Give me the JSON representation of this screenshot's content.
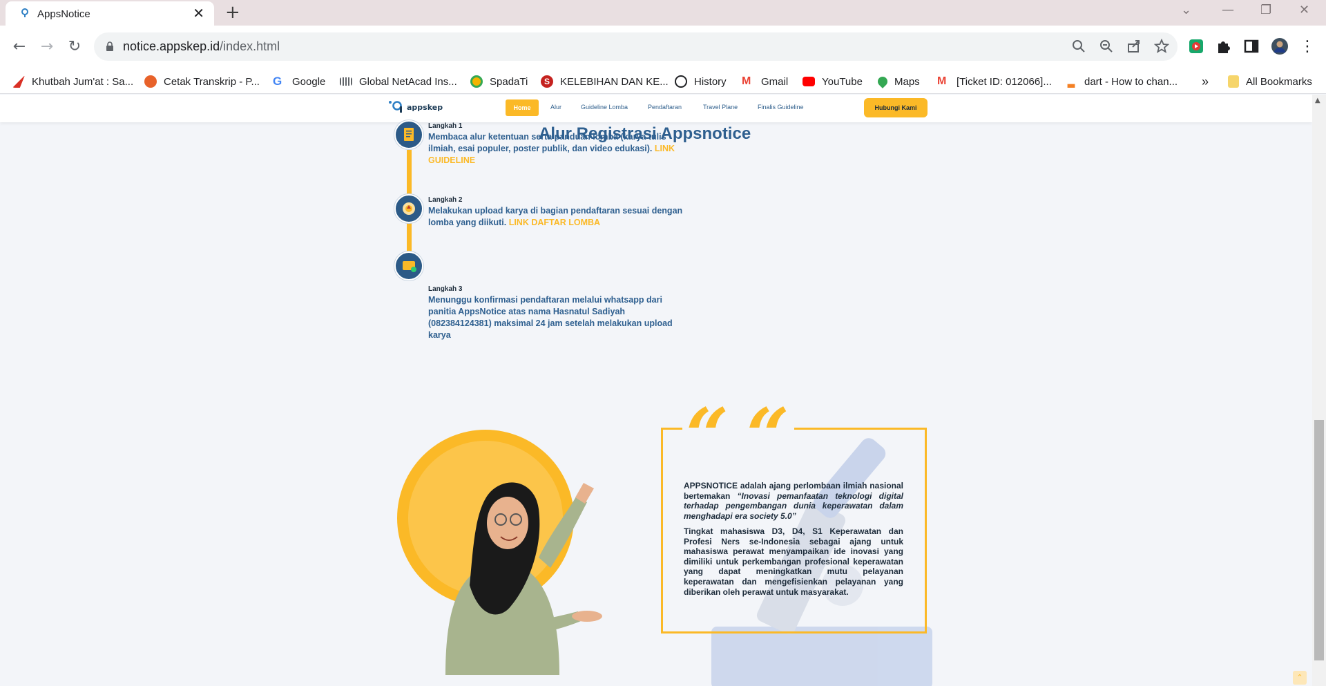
{
  "browser": {
    "tab_title": "AppsNotice",
    "url_host": "notice.appskep.id",
    "url_path": "/index.html",
    "bookmarks": [
      {
        "label": "Khutbah Jum'at : Sa...",
        "color": "#d93025"
      },
      {
        "label": "Cetak Transkrip - P...",
        "color": "#e8622a"
      },
      {
        "label": "Google",
        "color": "#4285f4"
      },
      {
        "label": "Global NetAcad Ins...",
        "color": "#5f6368"
      },
      {
        "label": "SpadaTi",
        "color": "#f4b400"
      },
      {
        "label": "KELEBIHAN DAN KE...",
        "color": "#c5221f"
      },
      {
        "label": "History",
        "color": "#202124"
      },
      {
        "label": "Gmail",
        "color": "#ea4335"
      },
      {
        "label": "YouTube",
        "color": "#ff0000"
      },
      {
        "label": "Maps",
        "color": "#34a853"
      },
      {
        "label": "[Ticket ID: 012066]...",
        "color": "#ea4335"
      },
      {
        "label": "dart - How to chan...",
        "color": "#f48024"
      }
    ],
    "overflow_label": "»",
    "all_bookmarks": "All Bookmarks"
  },
  "site": {
    "logo_text": "appskep",
    "nav": {
      "home": "Home",
      "alur": "Alur",
      "guideline": "Guideline Lomba",
      "pendaftaran": "Pendaftaran",
      "travel": "Travel Plane",
      "finalis": "Finalis Guideline",
      "cta": "Hubungi Kami"
    },
    "section_title": "Alur Registrasi Appsnotice",
    "steps": [
      {
        "label": "Langkah 1",
        "text": "Membaca alur ketentuan serta panduan lomba (karya tulis ilmiah, esai populer, poster publik, dan video edukasi).",
        "link": "LINK GUIDELINE",
        "icon": "document-icon"
      },
      {
        "label": "Langkah 2",
        "text": "Melakukan upload karya di bagian pendaftaran sesuai dengan lomba yang diikuti.",
        "link": "LINK DAFTAR LOMBA",
        "icon": "upload-icon"
      },
      {
        "label": "Langkah 3",
        "text": "Menunggu konfirmasi pendaftaran melalui whatsapp dari panitia AppsNotice atas nama Hasnatul Sadiyah (082384124381) maksimal 24 jam setelah melakukan upload karya",
        "link": "",
        "icon": "message-icon"
      }
    ],
    "quote": {
      "marks": "“ “",
      "p1_lead": "APPSNOTICE adalah ajang perlombaan ilmiah nasional bertemakan",
      "p1_theme": "“Inovasi pemanfaatan teknologi digital terhadap pengembangan dunia keperawatan dalam menghadapi era society 5.0”",
      "p2": "Tingkat mahasiswa D3, D4, S1 Keperawatan dan Profesi Ners se-Indonesia sebagai ajang untuk mahasiswa perawat menyampaikan ide inovasi yang dimiliki untuk perkembangan profesional keperawatan yang dapat meningkatkan mutu pelayanan keperawatan dan mengefisienkan pelayanan yang diberikan oleh perawat untuk masyarakat."
    },
    "accent": "#fbb927",
    "primary": "#2e5f8f"
  }
}
